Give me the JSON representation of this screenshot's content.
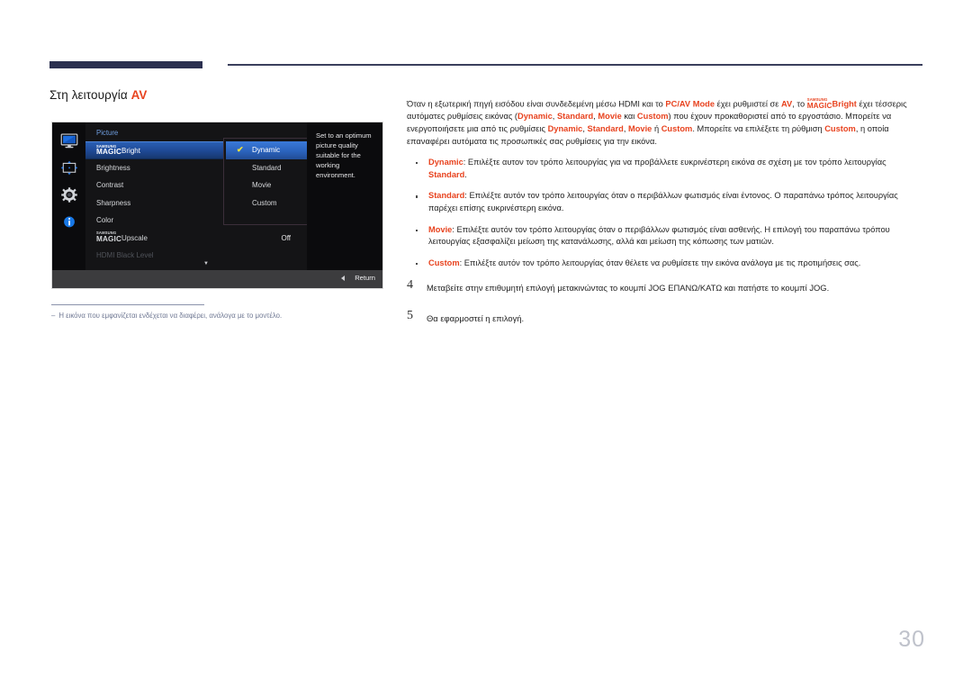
{
  "header": {
    "rule": "decorative-top-rule"
  },
  "section": {
    "title_prefix": "Στη λειτουργία ",
    "title_accent": "AV"
  },
  "osd": {
    "rail_icons": [
      "monitor-icon",
      "picture-size-icon",
      "gear-icon",
      "info-icon"
    ],
    "panel_title": "Picture",
    "menu_items": [
      {
        "samsung": "SAMSUNG",
        "magic": "MAGIC",
        "label": "Bright",
        "value": "",
        "selected": true,
        "dimmed": false
      },
      {
        "samsung": "",
        "magic": "",
        "label": "Brightness",
        "value": "",
        "selected": false,
        "dimmed": false
      },
      {
        "samsung": "",
        "magic": "",
        "label": "Contrast",
        "value": "",
        "selected": false,
        "dimmed": false
      },
      {
        "samsung": "",
        "magic": "",
        "label": "Sharpness",
        "value": "",
        "selected": false,
        "dimmed": false
      },
      {
        "samsung": "",
        "magic": "",
        "label": "Color",
        "value": "",
        "selected": false,
        "dimmed": false
      },
      {
        "samsung": "SAMSUNG",
        "magic": "MAGIC",
        "label": "Upscale",
        "value": "Off",
        "selected": false,
        "dimmed": false
      },
      {
        "samsung": "",
        "magic": "",
        "label": "HDMI Black Level",
        "value": "",
        "selected": false,
        "dimmed": true
      }
    ],
    "scroll_down_glyph": "▼",
    "submenu": {
      "items": [
        {
          "label": "Dynamic",
          "selected": true
        },
        {
          "label": "Standard",
          "selected": false
        },
        {
          "label": "Movie",
          "selected": false
        },
        {
          "label": "Custom",
          "selected": false
        }
      ],
      "check_glyph": "✔"
    },
    "help_text": "Set to an optimum picture quality suitable for the working environment.",
    "footer": {
      "return_label": "Return",
      "back_arrow": "left-triangle-icon"
    },
    "colors": {
      "highlight_blue": "#2a5fb4",
      "submenu_blue": "#3a79d8",
      "check_yellow": "#f4e53a",
      "panel_title_blue": "#6f9ee0",
      "background": "#0c0c0e",
      "footer": "#3c3c3e"
    }
  },
  "note": {
    "dash": "‒",
    "text": "Η εικόνα που εμφανίζεται ενδέχεται να διαφέρει, ανάλογα με το μοντέλο."
  },
  "body": {
    "paragraph": {
      "p1": "Όταν η εξωτερική πηγή εισόδου είναι συνδεδεμένη μέσω HDMI και το ",
      "hl1": "PC/AV Mode",
      "p2": " έχει ρυθμιστεί σε ",
      "hl2": "AV",
      "p3": ", το ",
      "magic_samsung": "SAMSUNG",
      "magic_magic": "MAGIC",
      "magic_suffix": "Bright",
      "p4": " έχει τέσσερις αυτόματες ρυθμίσεις εικόνας (",
      "hl3": "Dynamic",
      "p5": ", ",
      "hl4": "Standard",
      "p6": ", ",
      "hl5": "Movie",
      "p7": " και ",
      "hl6": "Custom",
      "p8": ") που έχουν προκαθοριστεί από το εργοστάσιο. Μπορείτε να ενεργοποιήσετε μια από τις ρυθμίσεις ",
      "hl7": "Dynamic",
      "p9": ", ",
      "hl8": "Standard",
      "p10": ", ",
      "hl9": "Movie",
      "p11": " ή ",
      "hl10": "Custom",
      "p12": ". Μπορείτε να επιλέξετε τη ρύθμιση ",
      "hl11": "Custom",
      "p13": ", η οποία επαναφέρει αυτόματα τις προσωπικές σας ρυθμίσεις για την εικόνα."
    },
    "bullets": [
      {
        "term": "Dynamic",
        "text_before": ": Επιλέξτε αυτον τον τρόπο λειτουργίας για να προβάλλετε ευκρινέστερη εικόνα σε σχέση με τον τρόπο λειτουργίας ",
        "inline_hl": "Standard",
        "text_after": "."
      },
      {
        "term": "Standard",
        "text_before": ": Επιλέξτε αυτόν τον τρόπο λειτουργίας όταν ο περιβάλλων φωτισμός είναι έντονος. Ο παραπάνω τρόπος λειτουργίας παρέχει επίσης ευκρινέστερη εικόνα.",
        "inline_hl": "",
        "text_after": ""
      },
      {
        "term": "Movie",
        "text_before": ": Επιλέξτε αυτόν τον τρόπο λειτουργίας όταν ο περιβάλλων φωτισμός είναι ασθενής. Η επιλογή του παραπάνω τρόπου λειτουργίας εξασφαλίζει μείωση της κατανάλωσης, αλλά και μείωση της κόπωσης των ματιών.",
        "inline_hl": "",
        "text_after": ""
      },
      {
        "term": "Custom",
        "text_before": ": Επιλέξτε αυτόν τον τρόπο λειτουργίας όταν θέλετε να ρυθμίσετε την εικόνα ανάλογα με τις προτιμήσεις σας.",
        "inline_hl": "",
        "text_after": ""
      }
    ],
    "steps": [
      {
        "num": "4",
        "text": "Μεταβείτε στην επιθυμητή επιλογή μετακινώντας το κουμπί JOG ΕΠΑΝΩ/ΚΑΤΩ και πατήστε το κουμπί JOG."
      },
      {
        "num": "5",
        "text": "Θα εφαρμοστεί η επιλογή."
      }
    ]
  },
  "footer": {
    "page_number": "30"
  }
}
